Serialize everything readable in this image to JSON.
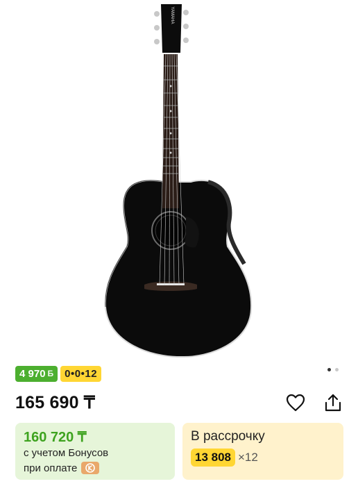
{
  "gallery": {
    "image_name": "yamaha-acoustic-guitar-black",
    "headstock_brand": "YAMAHA",
    "page_count": 2,
    "active_page": 1
  },
  "badges": {
    "bonus_value": "4 970",
    "bonus_currency": "Б",
    "installment_plan": "0•0•12"
  },
  "product": {
    "price": "165 690 ₸"
  },
  "bonus_card": {
    "price": "160 720 ₸",
    "line1": "с учетом Бонусов",
    "line2": "при оплате",
    "payment_icon": "kaspi-logo-icon"
  },
  "credit_card": {
    "title": "В рассрочку",
    "amount": "13 808",
    "multiplier": "×12"
  },
  "colors": {
    "bonus_green": "#4caf2f",
    "bonus_price_green": "#3ea31f",
    "installment_yellow": "#ffd633",
    "bonus_card_bg": "#e6f5d9",
    "credit_card_bg": "#fff2cc"
  }
}
